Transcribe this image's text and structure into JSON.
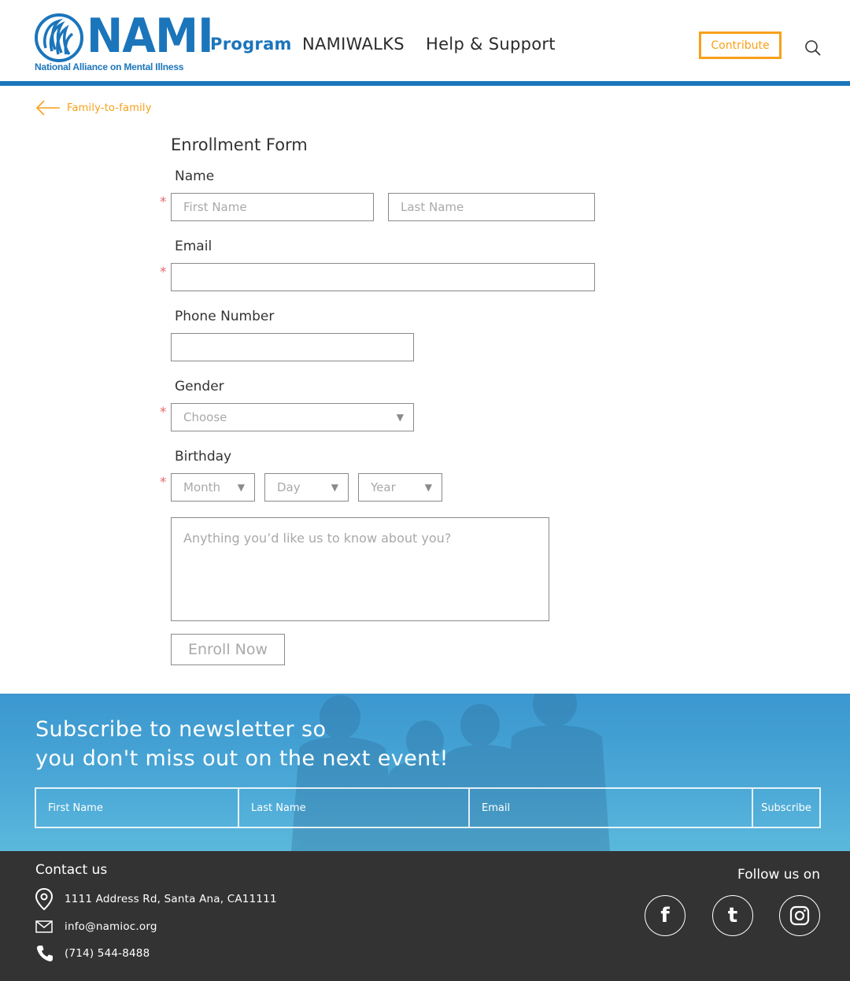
{
  "header": {
    "logo": {
      "word": "NAMI",
      "subtitle": "National Alliance on Mental Illness"
    },
    "nav": [
      {
        "label": "Program",
        "active": true
      },
      {
        "label": "NAMIWALKS",
        "active": false
      },
      {
        "label": "Help & Support",
        "active": false
      }
    ],
    "contribute_label": "Contribute",
    "search_icon": "search-icon"
  },
  "back_link": {
    "label": "Family-to-family",
    "icon": "arrow-left-icon"
  },
  "form": {
    "title": "Enrollment Form",
    "name": {
      "label": "Name",
      "first_placeholder": "First Name",
      "last_placeholder": "Last Name",
      "required": "*"
    },
    "email": {
      "label": "Email",
      "required": "*",
      "value": ""
    },
    "phone": {
      "label": "Phone Number",
      "value": ""
    },
    "gender": {
      "label": "Gender",
      "selected": "Choose",
      "required": "*"
    },
    "birthday": {
      "label": "Birthday",
      "month": "Month",
      "day": "Day",
      "year": "Year",
      "required": "*"
    },
    "notes_placeholder": "Anything you’d like us to know about you?",
    "enroll_label": "Enroll Now"
  },
  "newsletter": {
    "title_line1": "Subscribe to newsletter so",
    "title_line2": "you don't miss out on the next event!",
    "first_placeholder": "First Name",
    "last_placeholder": "Last Name",
    "email_placeholder": "Email",
    "subscribe_label": "Subscribe"
  },
  "footer": {
    "contact_title": "Contact us",
    "address": "1111 Address Rd, Santa Ana, CA11111",
    "email": "info@namioc.org",
    "phone": "(714) 544-8488",
    "follow_title": "Follow us on",
    "social": [
      {
        "name": "facebook",
        "glyph": "f"
      },
      {
        "name": "tumblr",
        "glyph": "t"
      },
      {
        "name": "instagram",
        "glyph": ""
      }
    ]
  },
  "colors": {
    "brand_blue": "#1b75bb",
    "accent_orange": "#f7a11a",
    "required_red": "#e86a6a",
    "footer_bg": "#333333"
  }
}
